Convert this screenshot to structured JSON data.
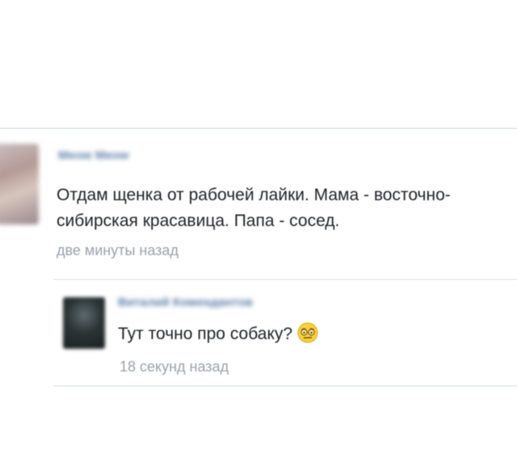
{
  "post": {
    "author": "Meow Meow",
    "text_lines": [
      "Отдам щенка от рабочей лайки. Мама - восточно-",
      "сибирская красавица. Папа - сосед."
    ],
    "time": "две минуты назад"
  },
  "reply": {
    "author": "Виталий Комендантов",
    "text": "Тут точно про собаку?",
    "emoji_icon": "skeptical-face-with-glasses-icon",
    "time": "18 секунд назад"
  },
  "colors": {
    "author_link": "#5b7ea8",
    "body_text": "#1f2227",
    "meta_text": "#9aa1ab",
    "divider": "#e3e6ea"
  }
}
